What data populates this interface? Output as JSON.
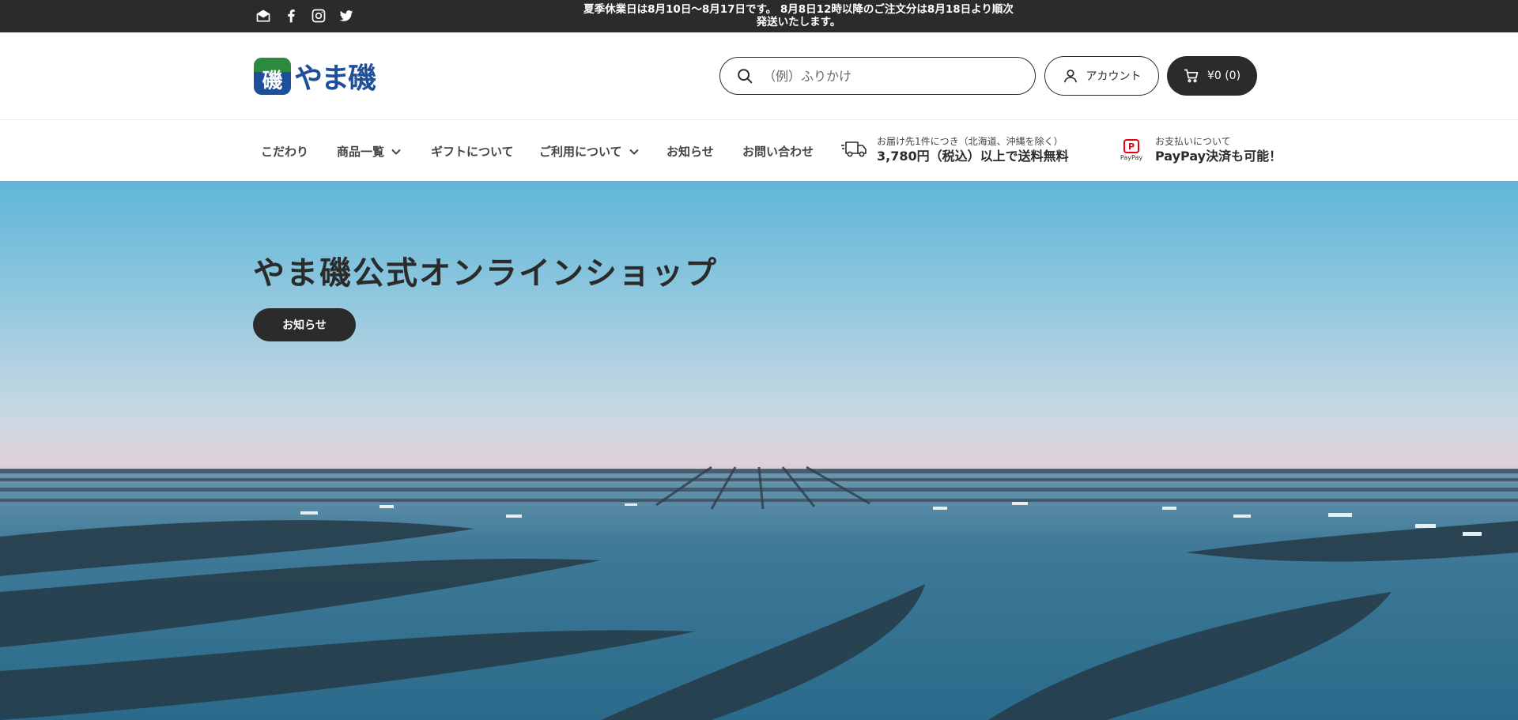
{
  "announcement": {
    "line1": "夏季休業日は8月10日〜8月17日です。 8月8日12時以降のご注文分は8月18日より順次",
    "line2": "発送いたします。"
  },
  "social_icons": [
    "mail-icon",
    "facebook-icon",
    "instagram-icon",
    "twitter-icon"
  ],
  "header": {
    "logo_text": "やま磯",
    "logo_mark": "磯",
    "search_placeholder": "（例）ふりかけ",
    "account_label": "アカウント",
    "cart_label": "¥0 (0)"
  },
  "nav": {
    "items": [
      {
        "label": "こだわり",
        "dropdown": false
      },
      {
        "label": "商品一覧",
        "dropdown": true
      },
      {
        "label": "ギフトについて",
        "dropdown": false
      },
      {
        "label": "ご利用について",
        "dropdown": true
      },
      {
        "label": "お知らせ",
        "dropdown": false
      },
      {
        "label": "お問い合わせ",
        "dropdown": false
      }
    ],
    "shipping": {
      "small": "お届け先1件につき（北海道、沖縄を除く）",
      "big": "3,780円（税込）以上で送料無料"
    },
    "payment": {
      "small": "お支払いについて",
      "big": "PayPay決済も可能！",
      "logo_text": "PayPay"
    }
  },
  "hero": {
    "title": "やま磯公式オンラインショップ",
    "button_label": "お知らせ"
  },
  "colors": {
    "dark": "#2b2b2b",
    "brand_blue": "#1d4f9a",
    "brand_green": "#2b8a3e",
    "paypay_red": "#e60012"
  }
}
